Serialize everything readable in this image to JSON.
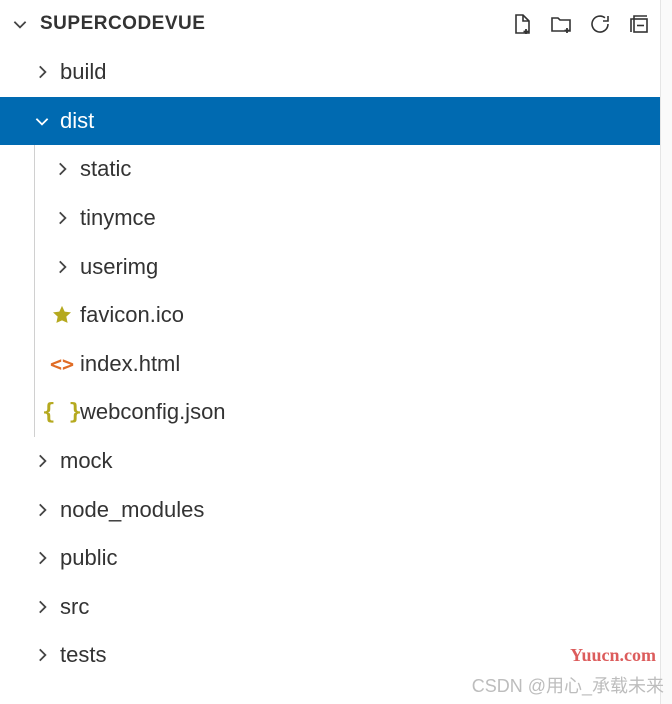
{
  "header": {
    "title": "SUPERCODEVUE"
  },
  "tree": {
    "items": [
      {
        "type": "folder",
        "label": "build",
        "depth": 0,
        "expanded": false,
        "selected": false
      },
      {
        "type": "folder",
        "label": "dist",
        "depth": 0,
        "expanded": true,
        "selected": true
      },
      {
        "type": "folder",
        "label": "static",
        "depth": 1,
        "expanded": false,
        "selected": false
      },
      {
        "type": "folder",
        "label": "tinymce",
        "depth": 1,
        "expanded": false,
        "selected": false
      },
      {
        "type": "folder",
        "label": "userimg",
        "depth": 1,
        "expanded": false,
        "selected": false
      },
      {
        "type": "file",
        "label": "favicon.ico",
        "depth": 1,
        "icon": "star",
        "selected": false
      },
      {
        "type": "file",
        "label": "index.html",
        "depth": 1,
        "icon": "html",
        "selected": false
      },
      {
        "type": "file",
        "label": "webconfig.json",
        "depth": 1,
        "icon": "json",
        "selected": false
      },
      {
        "type": "folder",
        "label": "mock",
        "depth": 0,
        "expanded": false,
        "selected": false
      },
      {
        "type": "folder",
        "label": "node_modules",
        "depth": 0,
        "expanded": false,
        "selected": false
      },
      {
        "type": "folder",
        "label": "public",
        "depth": 0,
        "expanded": false,
        "selected": false
      },
      {
        "type": "folder",
        "label": "src",
        "depth": 0,
        "expanded": false,
        "selected": false
      },
      {
        "type": "folder",
        "label": "tests",
        "depth": 0,
        "expanded": false,
        "selected": false
      }
    ]
  },
  "watermarks": {
    "top": "Yuucn.com",
    "bottom": "CSDN @用心_承载未来"
  }
}
